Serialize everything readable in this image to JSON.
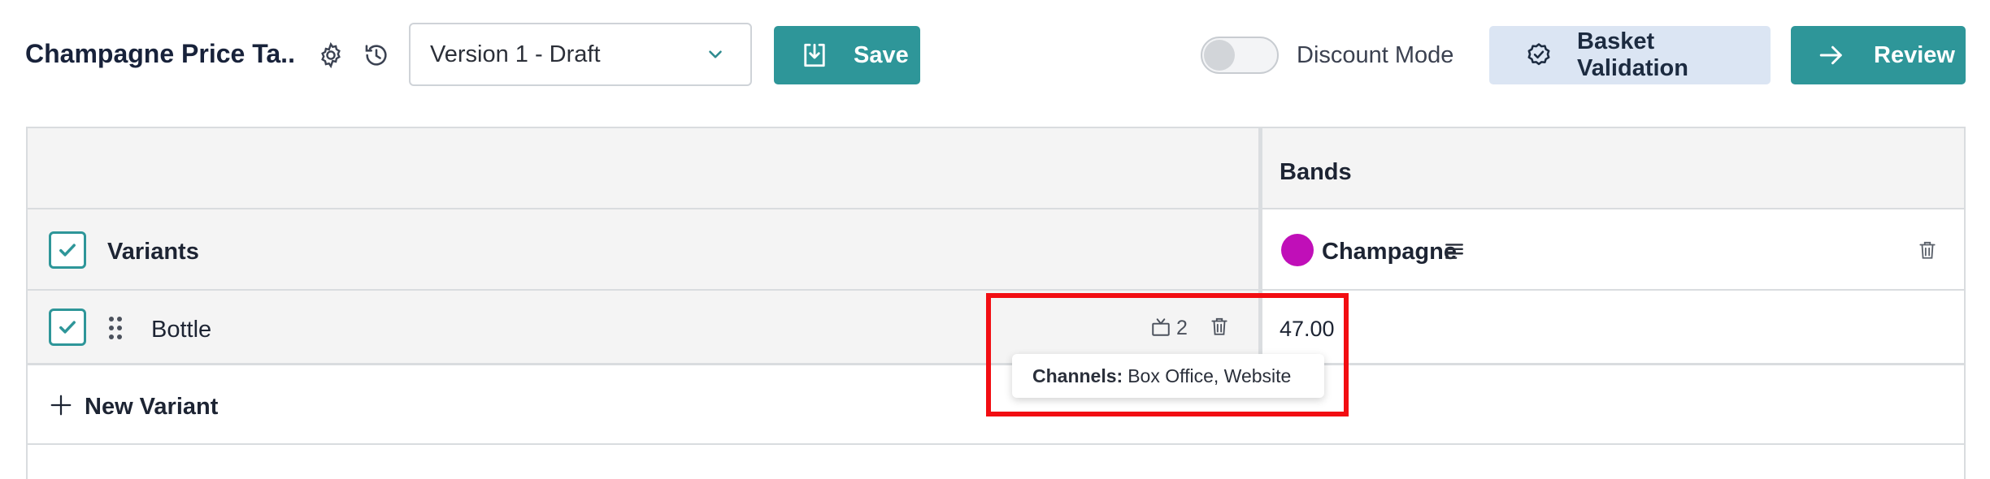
{
  "header": {
    "title": "Champagne Price Ta...",
    "settings_icon": "gear-icon",
    "history_icon": "history-icon",
    "version_select": {
      "value": "Version 1 - Draft"
    },
    "save_label": "Save",
    "discount_mode": {
      "label": "Discount Mode",
      "enabled": false
    },
    "basket_validation_label": "Basket Validation",
    "review_label": "Review"
  },
  "table": {
    "bands_header": "Bands",
    "variants_header": "Variants",
    "band": {
      "name": "Champagne",
      "color": "#c00fb8"
    },
    "rows": [
      {
        "name": "Bottle",
        "channel_count": "2",
        "price": "47.00",
        "checked": true
      }
    ],
    "new_variant_label": "New Variant"
  },
  "tooltip": {
    "key": "Channels:",
    "value": "Box Office, Website"
  },
  "colors": {
    "accent": "#2e9699",
    "basket_bg": "#dbe5f3",
    "highlight": "#f20d12"
  }
}
